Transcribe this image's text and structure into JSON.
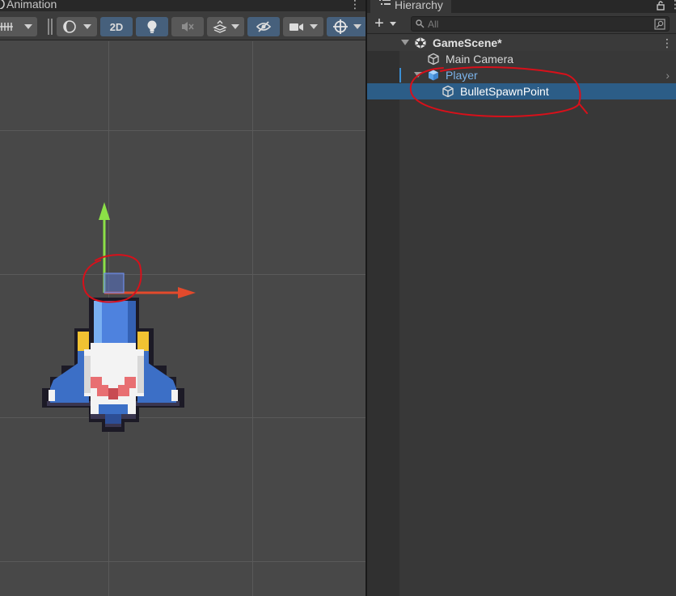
{
  "scene": {
    "tab_label": "Animation",
    "toolbar": {
      "mode_2d_label": "2D"
    }
  },
  "hierarchy": {
    "tab_label": "Hierarchy",
    "search": {
      "placeholder": "All"
    },
    "items": [
      {
        "label": "GameScene*",
        "type": "scene",
        "expanded": true
      },
      {
        "label": "Main Camera",
        "type": "gameobject"
      },
      {
        "label": "Player",
        "type": "prefab",
        "expanded": true,
        "color": "#7cb4ea"
      },
      {
        "label": "BulletSpawnPoint",
        "type": "gameobject",
        "selected": true
      }
    ]
  },
  "colors": {
    "selection": "#2c5d87",
    "prefab_text": "#7cb4ea",
    "annotation": "#d8101a",
    "gizmo_y": "#8ce047",
    "gizmo_x": "#e24a2c"
  },
  "icons": {
    "scene": "unity-scene-icon",
    "gameobject": "cube-outline-icon",
    "prefab": "prefab-cube-icon"
  }
}
